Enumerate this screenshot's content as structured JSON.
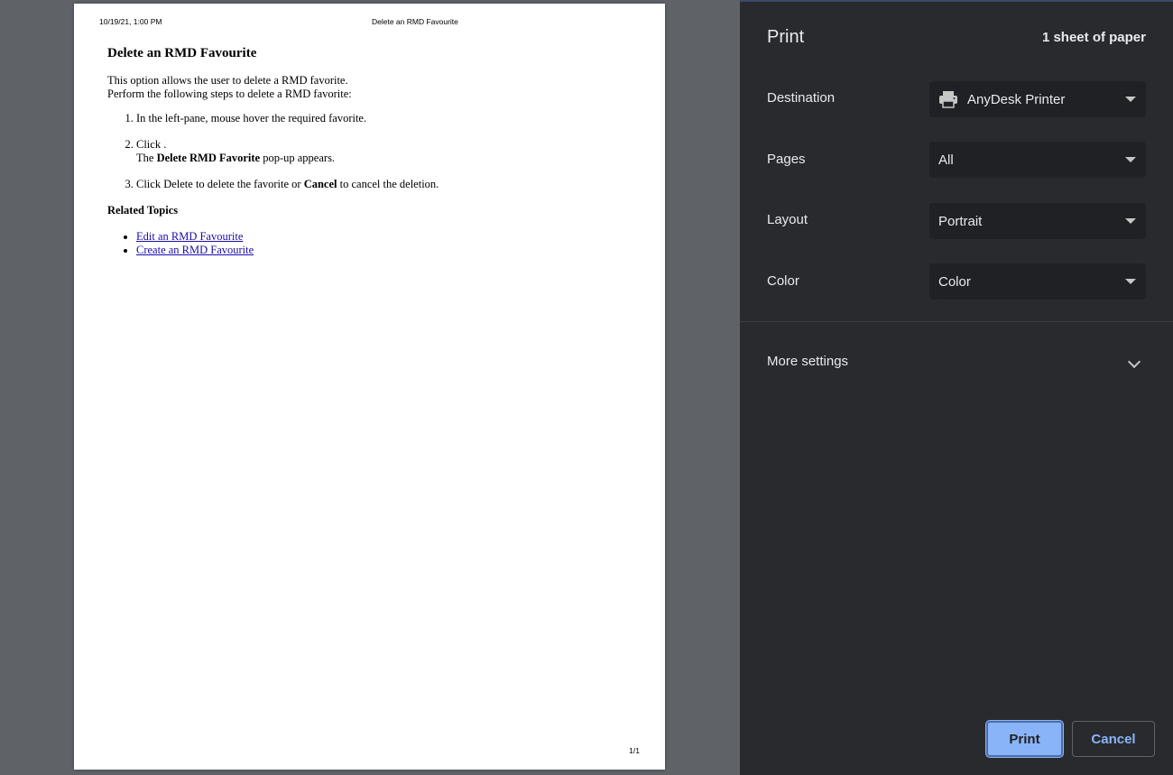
{
  "preview": {
    "header_date": "10/19/21, 1:00 PM",
    "header_title": "Delete an RMD Favourite",
    "footer_page": "1/1",
    "doc": {
      "heading": "Delete an RMD Favourite",
      "intro_line1": "This option allows the user to delete a RMD favorite.",
      "intro_line2": "Perform the following steps to delete a RMD favorite:",
      "step1": "In the left-pane, mouse hover the required favorite.",
      "step2_line1": "Click .",
      "step2_line2_pre": "The ",
      "step2_line2_bold": "Delete RMD Favorite",
      "step2_line2_post": " pop-up appears.",
      "step3_pre": "Click Delete to delete the favorite or ",
      "step3_bold": "Cancel",
      "step3_post": " to cancel the deletion.",
      "related_heading": "Related Topics",
      "links": [
        "Edit an RMD Favourite",
        "Create an RMD Favourite"
      ]
    }
  },
  "settings": {
    "title": "Print",
    "sheet_count": "1 sheet of paper",
    "destination": {
      "label": "Destination",
      "value": "AnyDesk Printer",
      "icon": "printer-icon"
    },
    "pages": {
      "label": "Pages",
      "value": "All"
    },
    "layout": {
      "label": "Layout",
      "value": "Portrait"
    },
    "color": {
      "label": "Color",
      "value": "Color"
    },
    "more_settings": "More settings",
    "print_button": "Print",
    "cancel_button": "Cancel"
  },
  "colors": {
    "sidebar_bg": "#292a2d",
    "select_bg": "#202124",
    "accent": "#8ab4f8",
    "preview_bg": "#5f6368"
  }
}
